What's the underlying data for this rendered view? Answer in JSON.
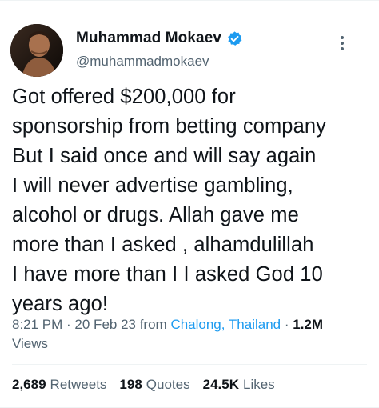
{
  "author": {
    "display_name": "Muhammad Mokaev",
    "handle": "@muhammadmokaev",
    "verified_icon": "verified-badge-icon",
    "avatar_icon": "user-avatar"
  },
  "tweet": {
    "lines": [
      "Got offered $200,000 for",
      "sponsorship from betting company",
      "But I said once and will say again",
      "I will never advertise gambling,",
      "alcohol or drugs. Allah gave me",
      "more than I asked , alhamdulillah",
      "I have more than I I asked God 10",
      "years ago!"
    ]
  },
  "meta": {
    "time": "8:21 PM",
    "sep1": " · ",
    "date": "20 Feb 23",
    "from_label": " from ",
    "location": "Chalong, Thailand",
    "sep2": " · ",
    "views_count": "1.2M",
    "views_label": "Views"
  },
  "stats": {
    "retweets_count": "2,689",
    "retweets_label": "Retweets",
    "quotes_count": "198",
    "quotes_label": "Quotes",
    "likes_count": "24.5K",
    "likes_label": "Likes"
  },
  "colors": {
    "accent": "#1d9bf0",
    "secondary_text": "#536471",
    "primary_text": "#0f1419"
  }
}
